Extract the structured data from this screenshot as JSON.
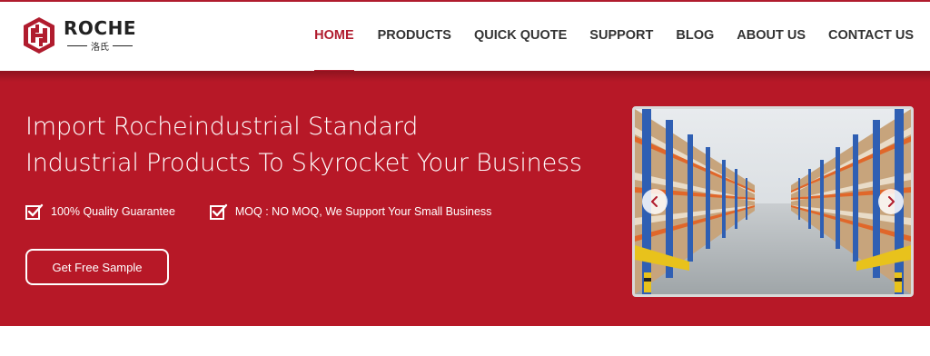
{
  "brand": {
    "name": "ROCHE",
    "sub": "洛氏",
    "accent_color": "#b01c2e",
    "hero_color": "#b71827"
  },
  "nav": {
    "items": [
      {
        "label": "HOME",
        "active": true
      },
      {
        "label": "PRODUCTS",
        "active": false
      },
      {
        "label": "QUICK QUOTE",
        "active": false
      },
      {
        "label": "SUPPORT",
        "active": false
      },
      {
        "label": "BLOG",
        "active": false
      },
      {
        "label": "ABOUT US",
        "active": false
      },
      {
        "label": "CONTACT US",
        "active": false
      }
    ]
  },
  "hero": {
    "headline_line1": "Import Rocheindustrial Standard",
    "headline_line2": "Industrial Products To Skyrocket Your Business",
    "features": [
      {
        "icon": "checkbox-icon",
        "label": "100% Quality Guarantee"
      },
      {
        "icon": "checkbox-icon",
        "label": "MOQ : NO MOQ, We Support Your Small Business"
      }
    ],
    "cta_label": "Get Free Sample"
  },
  "slider": {
    "image": "warehouse-racks-photo",
    "prev_icon": "chevron-left-icon",
    "next_icon": "chevron-right-icon"
  }
}
